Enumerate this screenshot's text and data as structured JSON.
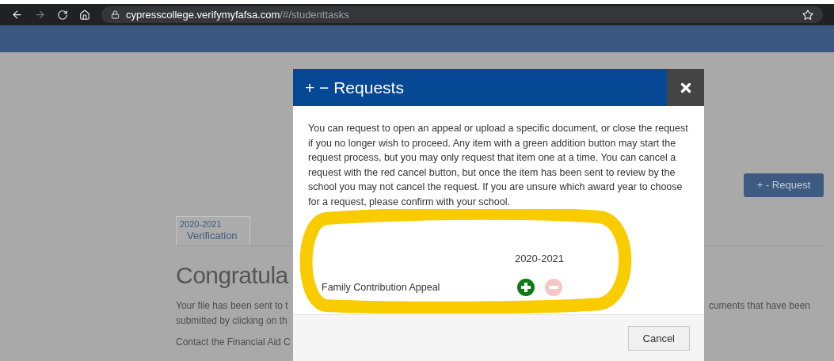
{
  "browser": {
    "url_host": "cypresscollege.verifymyfafsa.com",
    "url_path": "/#/studenttasks",
    "forward_disabled": true
  },
  "page": {
    "request_button": "+ - Request",
    "tabs": [
      {
        "year": "2020-2021",
        "label": "Verification",
        "selected": true
      }
    ],
    "heading": "Congratula",
    "paragraph_left": [
      "Your file has been sent to t",
      "submitted by clicking on th"
    ],
    "paragraph_right": "cuments that have been",
    "contact": "Contact the Financial Aid C"
  },
  "modal": {
    "title": "+ − Requests",
    "description": "You can request to open an appeal or upload a specific document, or close the request if you no longer wish to proceed. Any item with a green addition button may start the request process, but you may only request that item one at a time. You can cancel a request with the red cancel button, but once the item has been sent to review by the school you may not cancel the request. If you are unsure which award year to choose for a request, please confirm with your school.",
    "column": "2020-2021",
    "rows": [
      {
        "label": "Family Contribution Appeal",
        "actions": [
          {
            "kind": "add",
            "disabled": false
          },
          {
            "kind": "cancel",
            "disabled": true
          }
        ]
      }
    ],
    "cancel_button": "Cancel"
  }
}
